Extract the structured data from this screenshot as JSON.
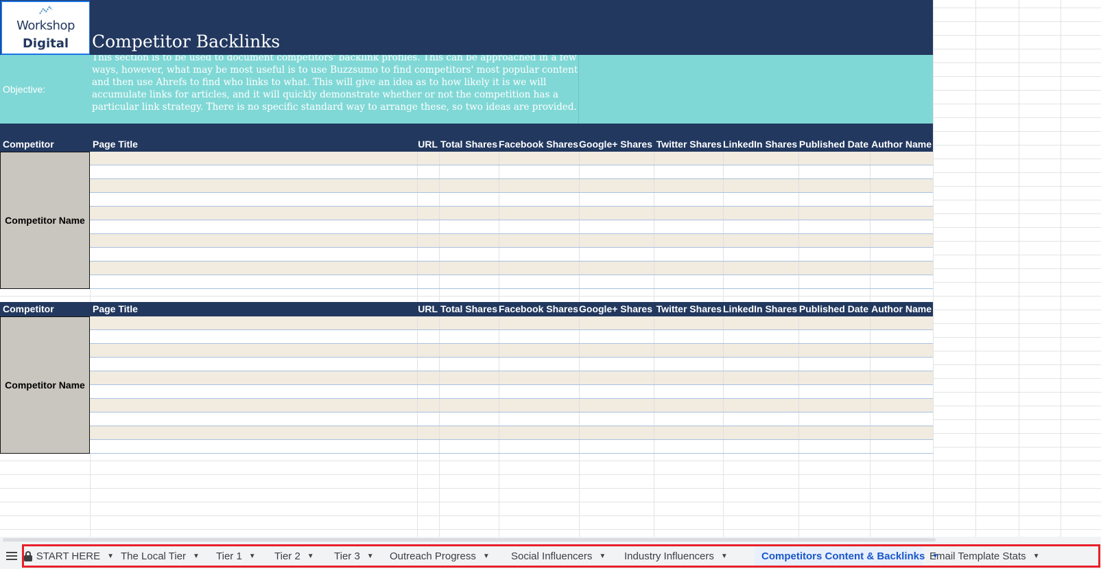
{
  "logo": {
    "line1": "Workshop",
    "line2": "Digital"
  },
  "sheet": {
    "title": "Competitor Backlinks",
    "objective_label": "Objective:",
    "objective_text": "This section is to be used to document competitors' backlink profiles. This can be approached in a few ways, however, what may be most useful is to use Buzzsumo to find competitors' most popular content and then use Ahrefs to find who links to what. This will give an idea as to how likely it is we will accumulate links for articles, and it will quickly demonstrate whether or not the competition has a particular link strategy. There is no specific standard way to arrange these, so two ideas are provided."
  },
  "table_headers": [
    "Competitor",
    "Page Title",
    "URL",
    "Total Shares",
    "Facebook Shares",
    "Google+ Shares",
    "Twitter Shares",
    "LinkedIn Shares",
    "Published Date",
    "Author Name"
  ],
  "tables": [
    {
      "competitor_name": "Competitor Name"
    },
    {
      "competitor_name": "Competitor Name"
    }
  ],
  "tabs": [
    {
      "label": "START HERE",
      "locked": true,
      "active": false
    },
    {
      "label": "The Local Tier",
      "active": false
    },
    {
      "label": "Tier 1",
      "active": false
    },
    {
      "label": "Tier 2",
      "active": false
    },
    {
      "label": "Tier 3",
      "active": false
    },
    {
      "label": "Outreach Progress",
      "active": false
    },
    {
      "label": "Social Influencers",
      "active": false
    },
    {
      "label": "Industry Influencers",
      "active": false
    },
    {
      "label": "Competitors Content & Backlinks",
      "active": true
    },
    {
      "label": "Email Template Stats",
      "active": false
    }
  ],
  "colors": {
    "header_navy": "#22385f",
    "objective_teal": "#80d8d6",
    "alt_row": "#f1ebe0",
    "competitor_cell": "#c9c6bf",
    "active_tab": "#1a57c8",
    "highlight_frame": "#e8202a"
  },
  "icons": {
    "menu": "hamburger-menu-icon",
    "lock": "lock-icon",
    "dropdown": "caret-down-icon"
  }
}
